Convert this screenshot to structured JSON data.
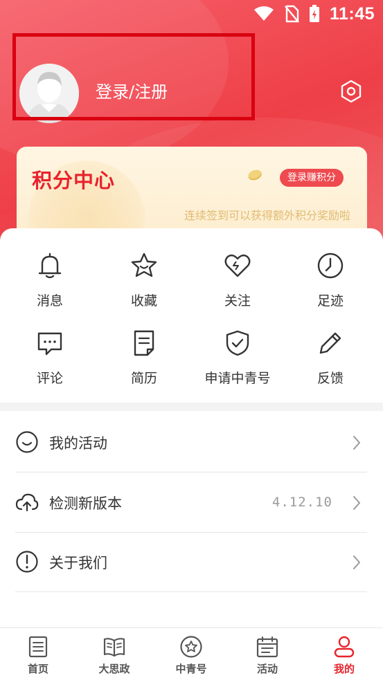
{
  "status_bar": {
    "time": "11:45"
  },
  "profile": {
    "login_label": "登录/注册"
  },
  "points_card": {
    "title": "积分中心",
    "earn_button": "登录赚积分",
    "tip": "连续签到可以获得额外积分奖励啦"
  },
  "quick_actions": [
    {
      "label": "消息",
      "icon": "bell-icon"
    },
    {
      "label": "收藏",
      "icon": "star-icon"
    },
    {
      "label": "关注",
      "icon": "heart-icon"
    },
    {
      "label": "足迹",
      "icon": "clock-icon"
    },
    {
      "label": "评论",
      "icon": "comment-icon"
    },
    {
      "label": "简历",
      "icon": "document-icon"
    },
    {
      "label": "申请中青号",
      "icon": "shield-check-icon"
    },
    {
      "label": "反馈",
      "icon": "pencil-icon"
    }
  ],
  "menu": [
    {
      "label": "我的活动",
      "icon": "smile-icon",
      "value": ""
    },
    {
      "label": "检测新版本",
      "icon": "cloud-upload-icon",
      "value": "4.12.10"
    },
    {
      "label": "关于我们",
      "icon": "info-icon",
      "value": ""
    }
  ],
  "tab_bar": [
    {
      "label": "首页",
      "icon": "home-doc-icon",
      "active": false
    },
    {
      "label": "大思政",
      "icon": "book-icon",
      "active": false
    },
    {
      "label": "中青号",
      "icon": "star-badge-icon",
      "active": false
    },
    {
      "label": "活动",
      "icon": "calendar-icon",
      "active": false
    },
    {
      "label": "我的",
      "icon": "person-icon",
      "active": true
    }
  ],
  "colors": {
    "brand_red": "#e8232d",
    "header_red": "#ee3f47",
    "highlight_box": "#d90010",
    "points_tip": "#e0bb72"
  }
}
